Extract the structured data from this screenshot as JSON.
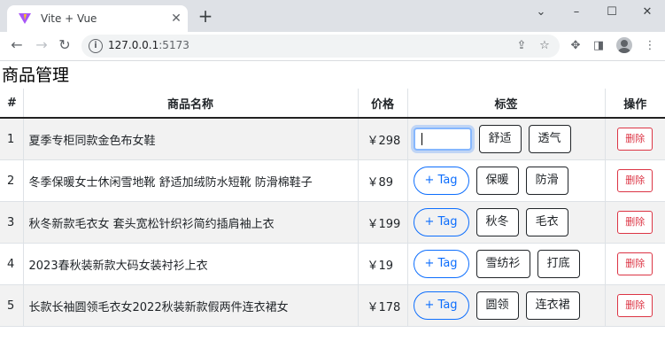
{
  "browser": {
    "tab_title": "Vite + Vue",
    "tab_close": "✕",
    "new_tab": "+",
    "url_host": "127.0.0.1",
    "url_port": ":5173",
    "window_controls": {
      "minimize": "–",
      "maximize": "☐",
      "close": "✕",
      "dropdown": "⌄"
    },
    "nav": {
      "back": "←",
      "forward": "→",
      "reload": "↻"
    }
  },
  "page": {
    "title": "商品管理",
    "columns": {
      "index": "#",
      "name": "商品名称",
      "price": "价格",
      "tags": "标签",
      "actions": "操作"
    },
    "add_tag_label": "+ Tag",
    "delete_label": "删除",
    "rows": [
      {
        "index": "1",
        "name": "夏季专柜同款金色布女鞋",
        "price": "￥298",
        "editing": true,
        "tags": [
          "舒适",
          "透气"
        ]
      },
      {
        "index": "2",
        "name": "冬季保暖女士休闲雪地靴 舒适加绒防水短靴 防滑棉鞋子",
        "price": "￥89",
        "editing": false,
        "tags": [
          "保暖",
          "防滑"
        ]
      },
      {
        "index": "3",
        "name": "秋冬新款毛衣女 套头宽松针织衫简约插肩袖上衣",
        "price": "￥199",
        "editing": false,
        "tags": [
          "秋冬",
          "毛衣"
        ]
      },
      {
        "index": "4",
        "name": "2023春秋装新款大码女装衬衫上衣",
        "price": "￥19",
        "editing": false,
        "tags": [
          "雪纺衫",
          "打底"
        ]
      },
      {
        "index": "5",
        "name": "长款长袖圆领毛衣女2022秋装新款假两件连衣裙女",
        "price": "￥178",
        "editing": false,
        "tags": [
          "圆领",
          "连衣裙"
        ]
      }
    ]
  },
  "colors": {
    "primary": "#0d6efd",
    "danger": "#dc3545",
    "stripe": "#f2f2f2",
    "chrome": "#dee1e6"
  }
}
